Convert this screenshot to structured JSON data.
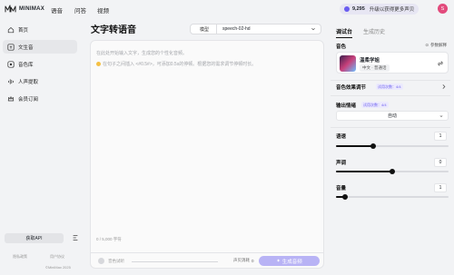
{
  "topbar": {
    "brand": "MINIMAX",
    "nav": [
      "语音",
      "问答",
      "视频"
    ],
    "credits": "9,295",
    "upgrade_label": "升级以获得更多声贝",
    "avatar_initial": "S"
  },
  "sidebar": {
    "items": [
      {
        "label": "首页",
        "icon": "home-icon"
      },
      {
        "label": "文生音",
        "icon": "sound-icon"
      },
      {
        "label": "音色库",
        "icon": "library-icon"
      },
      {
        "label": "人声提取",
        "icon": "extract-icon"
      },
      {
        "label": "会员订阅",
        "icon": "crown-icon"
      }
    ],
    "active_index": 1,
    "api_button": "获取API",
    "footer_links": [
      "隐私政策",
      "用户协议"
    ],
    "copyright": "©MiniMax 2025"
  },
  "main": {
    "title": "文字转语音",
    "model_label": "模型",
    "model_value": "speech-02-hd",
    "placeholder": "在此处开始输入文字，生成您的个性化音频。",
    "tip": "在句子之间插入 <#0.5#>，可添加0.5s的停顿。根据您的需求调节停顿时长。",
    "char_count": "0 / 5,000 字符",
    "preview_label": "音色试听",
    "vpt_label": "声贝消耗",
    "vpt_value": "0",
    "generate_button": "生成音频"
  },
  "panel": {
    "tabs": [
      "调试台",
      "生成历史"
    ],
    "active_tab": 0,
    "voice_section": "音色",
    "ref_doc": "参数解释",
    "voice_name": "温柔学姐",
    "voice_tags": "中文 · 普通话",
    "effect_section": "音色效果调节",
    "trial_badge": "试用次数：",
    "trial_count": "4/4",
    "emotion_section": "输出情绪",
    "emotion_value": "自动",
    "sliders": [
      {
        "label": "语速",
        "value": "1",
        "fraction": 0.33
      },
      {
        "label": "声调",
        "value": "0",
        "fraction": 0.5
      },
      {
        "label": "音量",
        "value": "1",
        "fraction": 0.08
      }
    ]
  }
}
